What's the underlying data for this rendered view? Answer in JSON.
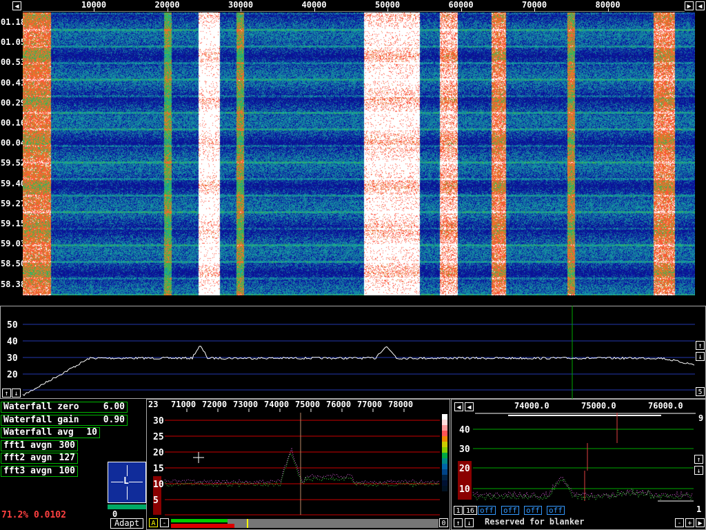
{
  "colors": {
    "green": "#00cc00",
    "red": "#cc0000",
    "blue": "#1a2a90",
    "accent_red": "#ff4040"
  },
  "waterfall": {
    "freq_labels": [
      "10000",
      "20000",
      "30000",
      "40000",
      "50000",
      "60000",
      "70000",
      "80000"
    ],
    "time_labels": [
      "01.18",
      "01.05",
      "00.53",
      "00.41",
      "00.29",
      "00.16",
      "00.04",
      "59.52",
      "59.40",
      "59.27",
      "59.15",
      "59.03",
      "58.50",
      "58.38"
    ],
    "left_icon": "arrow-left-icon",
    "right_icon": "arrow-right-icon"
  },
  "spectrum": {
    "y_labels": [
      "50",
      "40",
      "30",
      "20"
    ],
    "corner_value": "5"
  },
  "params": [
    {
      "label": "Waterfall zero",
      "value": "6.00"
    },
    {
      "label": "Waterfall gain",
      "value": "0.90"
    },
    {
      "label": "Waterfall avg",
      "value": "10"
    },
    {
      "label": "fft1 avgn",
      "value": "300"
    },
    {
      "label": "fft2 avgn",
      "value": "127"
    },
    {
      "label": "fft3 avgn",
      "value": "100"
    }
  ],
  "status": {
    "text": "71.2% 0.0102"
  },
  "meter": {
    "letter": "L",
    "value": "0",
    "adapt_label": "Adapt"
  },
  "baseband": {
    "top_left": "23",
    "freq_labels": [
      "71000",
      "72000",
      "73000",
      "74000",
      "75000",
      "76000",
      "77000",
      "78000"
    ],
    "y_labels": [
      "30",
      "25",
      "20",
      "15",
      "10",
      "5"
    ],
    "a_label": "A",
    "bottom_right": "0"
  },
  "hires": {
    "freq_labels": [
      "74000.0",
      "75000.0",
      "76000.0"
    ],
    "y_labels": [
      "40",
      "30",
      "20",
      "10"
    ],
    "top_right": "9",
    "bottom_right": "1",
    "btn1": "1",
    "btn16": "16",
    "off_labels": [
      "off",
      "off",
      "off",
      "off"
    ],
    "reserved": "Reserved for blanker",
    "minus": "-",
    "plus": "+"
  }
}
